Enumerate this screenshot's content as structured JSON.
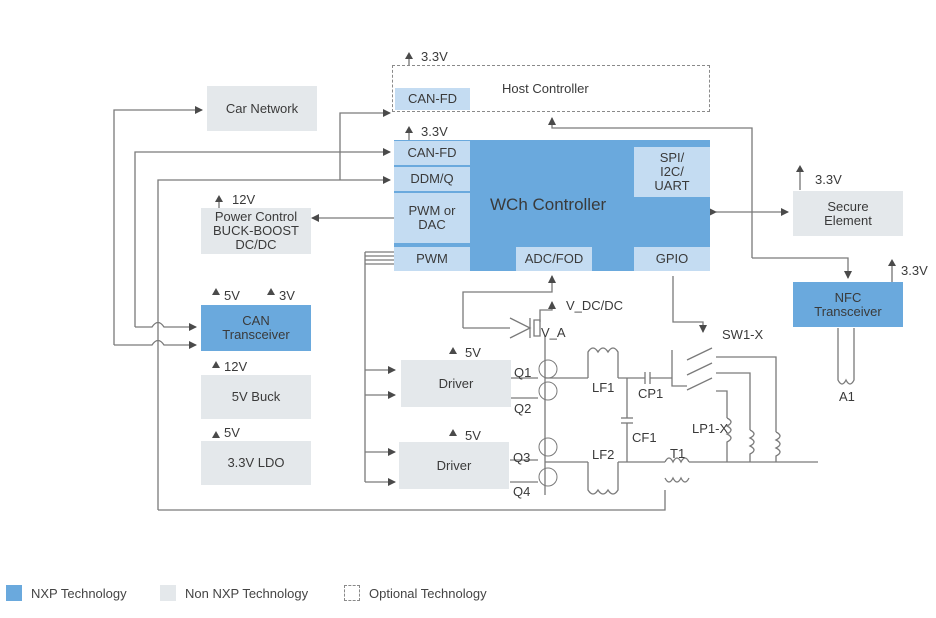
{
  "host_controller": {
    "title": "Host Controller",
    "port": "CAN-FD",
    "supply": "3.3V"
  },
  "car_network": {
    "title": "Car Network"
  },
  "wch_controller": {
    "title": "WCh Controller",
    "supply": "3.3V",
    "ports": {
      "can_fd": "CAN-FD",
      "ddm_q": "DDM/Q",
      "pwm_dac": "PWM or DAC",
      "pwm": "PWM",
      "adc_fod": "ADC/FOD",
      "spi": "SPI/ I2C/ UART",
      "gpio": "GPIO"
    }
  },
  "power_control": {
    "title": "Power Control BUCK-BOOST DC/DC",
    "supply": "12V"
  },
  "can_transceiver": {
    "title": "CAN Transceiver",
    "supply_a": "5V",
    "supply_b": "3V"
  },
  "buck_5v": {
    "title": "5V Buck",
    "supply": "12V"
  },
  "ldo_33v": {
    "title": "3.3V LDO",
    "supply": "5V"
  },
  "secure_element": {
    "title": "Secure Element",
    "supply": "3.3V"
  },
  "nfc_transceiver": {
    "title": "NFC Transceiver",
    "supply": "3.3V",
    "antenna": "A1"
  },
  "driver_1": {
    "title": "Driver",
    "supply": "5V"
  },
  "driver_2": {
    "title": "Driver",
    "supply": "5V"
  },
  "components": {
    "v_dcdc": "V_DC/DC",
    "v_a": "V_A",
    "q1": "Q1",
    "q2": "Q2",
    "q3": "Q3",
    "q4": "Q4",
    "lf1": "LF1",
    "lf2": "LF2",
    "cf1": "CF1",
    "cp1": "CP1",
    "t1": "T1",
    "sw1": "SW1-X",
    "lp1": "LP1-X"
  },
  "legend": [
    {
      "label": "NXP Technology",
      "color": "#6aa9dd"
    },
    {
      "label": "Non NXP Technology",
      "color": "#e4e8eb"
    },
    {
      "label": "Optional Technology",
      "style": "dashed"
    }
  ]
}
